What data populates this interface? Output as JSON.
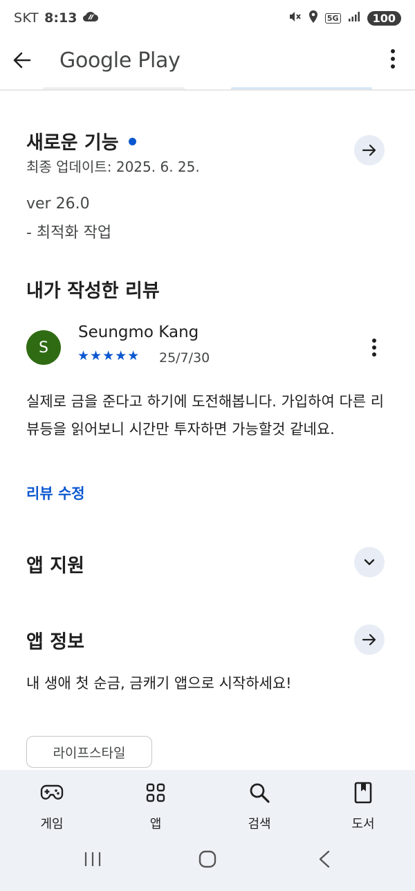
{
  "status": {
    "carrier": "SKT",
    "time": "8:13",
    "network": "5G",
    "battery": "100"
  },
  "app_bar": {
    "title": "Google Play"
  },
  "whats_new": {
    "title": "새로운 기능",
    "updated": "최종 업데이트: 2025. 6. 25.",
    "version": "ver 26.0",
    "notes": "- 최적화 작업"
  },
  "my_review": {
    "title": "내가 작성한 리뷰",
    "avatar_letter": "S",
    "reviewer": "Seungmo Kang",
    "stars": "★★★★★",
    "rating": 5,
    "date": "25/7/30",
    "body": "실제로 금을 준다고 하기에 도전해봅니다. 가입하여 다른 리뷰등을 읽어보니 시간만 투자하면 가능할것 같네요.",
    "edit_label": "리뷰 수정"
  },
  "app_support": {
    "title": "앱 지원"
  },
  "app_info": {
    "title": "앱 정보",
    "description": "내 생애 첫 순금, 금캐기 앱으로 시작하세요!",
    "category_chip": "라이프스타일"
  },
  "bottom_nav": {
    "items": [
      {
        "label": "게임",
        "icon": "gamepad-icon"
      },
      {
        "label": "앱",
        "icon": "apps-grid-icon"
      },
      {
        "label": "검색",
        "icon": "search-icon"
      },
      {
        "label": "도서",
        "icon": "book-icon"
      }
    ]
  },
  "colors": {
    "accent": "#0b57d0",
    "avatar": "#2f6b13",
    "nav_bg": "#eef1f6"
  }
}
